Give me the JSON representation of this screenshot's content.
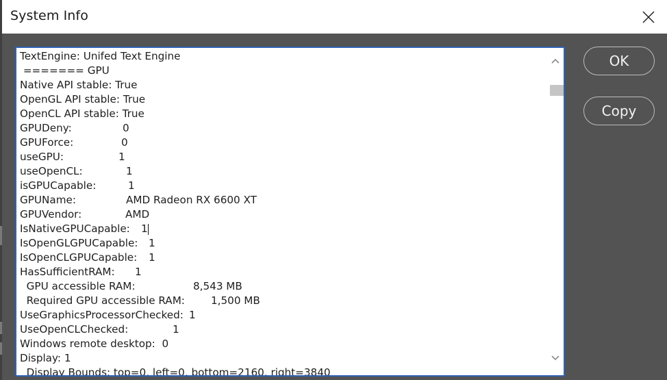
{
  "window": {
    "title": "System Info",
    "close_icon": "close-icon"
  },
  "buttons": {
    "ok_label": "OK",
    "copy_label": "Copy"
  },
  "scrollbar": {
    "up_icon": "chevron-up-icon",
    "down_icon": "chevron-down-icon"
  },
  "lines": [
    {
      "text": "TextEngine: Unifed Text Engine"
    },
    {
      "text": " ======= GPU"
    },
    {
      "text": "Native API stable: True"
    },
    {
      "text": "OpenGL API stable: True"
    },
    {
      "text": "OpenCL API stable: True"
    },
    {
      "key": "GPUDeny:",
      "value": "0"
    },
    {
      "key": "GPUForce:",
      "value": "0"
    },
    {
      "key": "useGPU:",
      "value": "1"
    },
    {
      "key": "useOpenCL:",
      "value": "1"
    },
    {
      "key": "isGPUCapable:",
      "value": "1"
    },
    {
      "key": "GPUName:",
      "value": "AMD Radeon RX 6600 XT"
    },
    {
      "key": "GPUVendor:",
      "value": "AMD"
    },
    {
      "key": "IsNativeGPUCapable:",
      "value": "1"
    },
    {
      "key": "IsOpenGLGPUCapable:",
      "value": "1"
    },
    {
      "key": "IsOpenCLGPUCapable:",
      "value": "1"
    },
    {
      "key": "HasSufficientRAM:",
      "value": "1"
    },
    {
      "key": "  GPU accessible RAM:",
      "value": "8,543 MB"
    },
    {
      "key": "  Required GPU accessible RAM:",
      "value": "1,500 MB"
    },
    {
      "key": "UseGraphicsProcessorChecked:",
      "value": "1"
    },
    {
      "key": "UseOpenCLChecked:",
      "value": "1"
    },
    {
      "text": "Windows remote desktop:  0"
    },
    {
      "text": "Display: 1"
    },
    {
      "text": "  Display Bounds: top=0, left=0, bottom=2160, right=3840"
    }
  ]
}
